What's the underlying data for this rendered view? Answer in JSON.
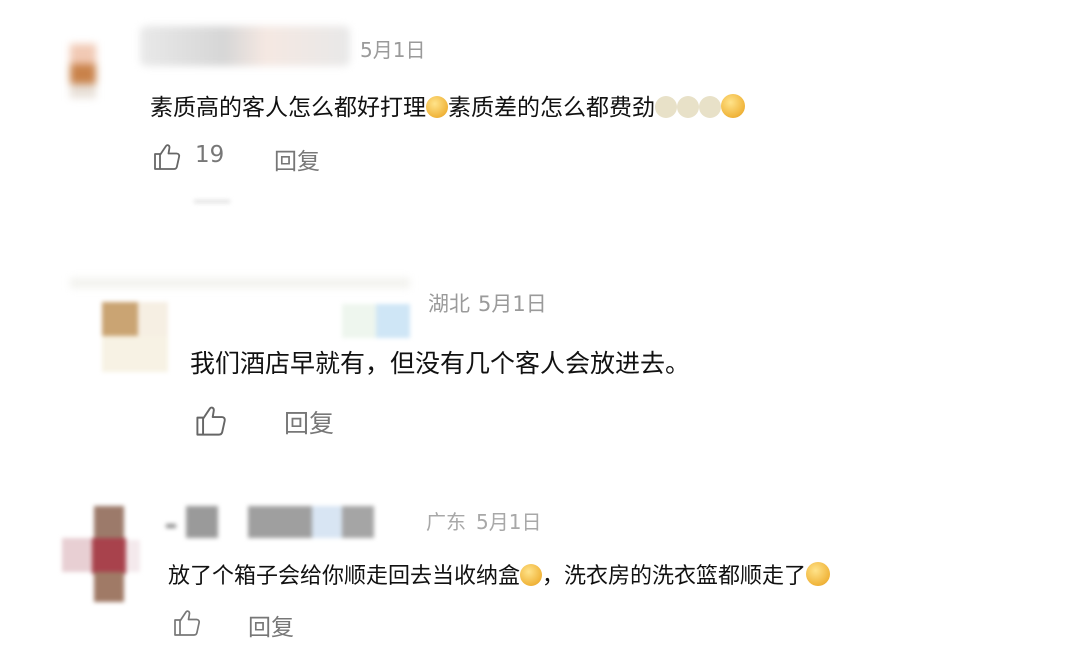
{
  "comments": [
    {
      "location": "",
      "date": "5月1日",
      "text_a": "素质高的客人怎么都好打理",
      "text_b": "素质差的怎么都费劲",
      "like_count": "19",
      "reply_label": "回复"
    },
    {
      "location": "湖北",
      "date": "5月1日",
      "text": "我们酒店早就有，但没有几个客人会放进去。",
      "reply_label": "回复"
    },
    {
      "location": "广东",
      "date": "5月1日",
      "text_a": "放了个箱子会给你顺走回去当收纳盒",
      "text_b": "，洗衣房的洗衣篮都顺走了",
      "reply_label": "回复"
    }
  ],
  "icons": [
    "like-icon",
    "laugh-emoji-icon",
    "cat-emoji-icon",
    "shy-emoji-icon"
  ]
}
